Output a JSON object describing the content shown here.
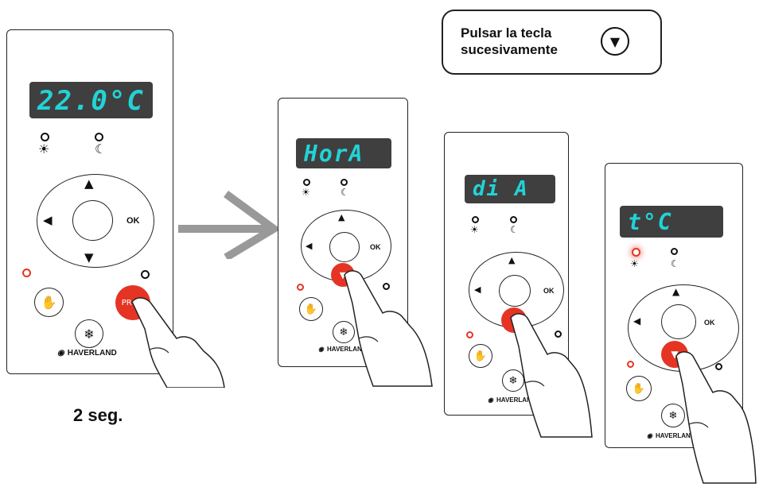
{
  "callout": {
    "text": "Pulsar la tecla\nsucesivamente",
    "key_icon": "double-chevron-down-icon"
  },
  "duration_label": "2 seg.",
  "colors": {
    "display_bg": "#3f3f40",
    "display_text": "#22d3d6",
    "accent_red": "#e53424",
    "arrow_gray": "#999999"
  },
  "panels": [
    {
      "display": "22.0°C",
      "indicators": [
        "sun-icon",
        "moon-icon"
      ],
      "ok_label": "OK",
      "prog_label": "PROG",
      "brand": "HAVERLAND",
      "pressed": "prog-button"
    },
    {
      "display": "HorA",
      "ok_label": "OK",
      "brand": "HAVERLAND",
      "pressed": "down-button"
    },
    {
      "display": "di A",
      "ok_label": "OK",
      "brand": "HAVERLAND",
      "pressed": "down-button"
    },
    {
      "display": "t°C",
      "ok_label": "OK",
      "brand": "HAVERLAND",
      "pressed": "down-button"
    }
  ]
}
